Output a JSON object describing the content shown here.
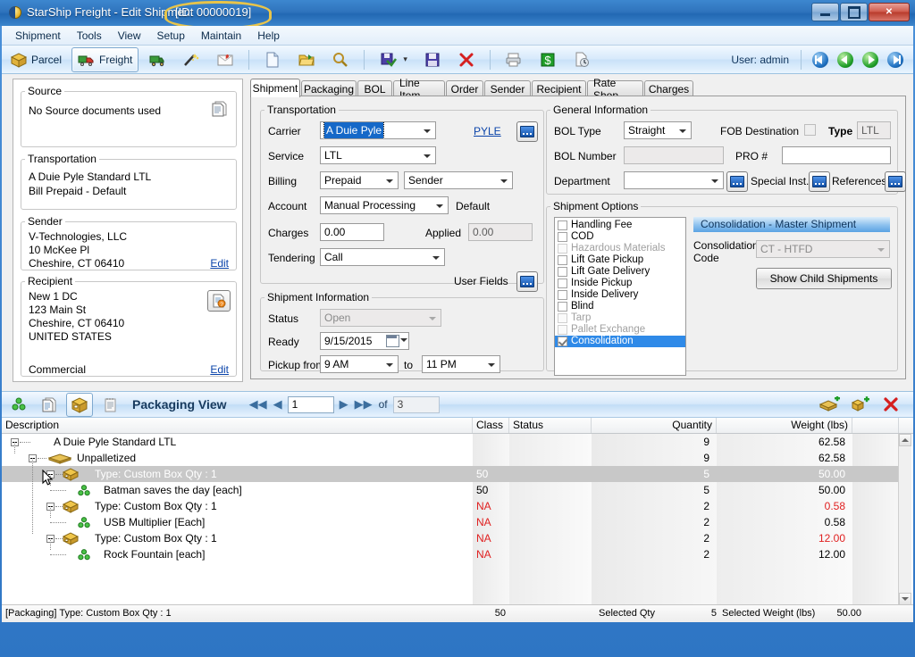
{
  "window": {
    "title": "StarShip Freight - Edit Shipment",
    "id_label": "[ID: 00000019]",
    "minimize": "–",
    "maximize": "□",
    "close": "✕"
  },
  "menu": [
    "Shipment",
    "Tools",
    "View",
    "Setup",
    "Maintain",
    "Help"
  ],
  "toolbar": {
    "parcel": "Parcel",
    "freight": "Freight",
    "user": "User: admin",
    "icons": [
      "truck-icon",
      "wand-icon",
      "mail-icon",
      "new-document-icon",
      "open-folder-icon",
      "search-icon",
      "save-process-icon",
      "save-icon",
      "delete-icon",
      "print-icon",
      "money-icon",
      "history-icon"
    ],
    "nav": [
      "first-record",
      "previous-record",
      "next-record",
      "last-record"
    ]
  },
  "left_panel": {
    "source": {
      "legend": "Source",
      "text": "No Source documents used",
      "icon": "documents-icon"
    },
    "transportation": {
      "legend": "Transportation",
      "line1": "A Duie Pyle Standard LTL",
      "line2": "Bill Prepaid - Default"
    },
    "sender": {
      "legend": "Sender",
      "line1": "V-Technologies, LLC",
      "line2": "10 McKee Pl",
      "line3": "Cheshire, CT 06410",
      "edit": "Edit"
    },
    "recipient": {
      "legend": "Recipient",
      "line1": "New 1 DC",
      "line2": "123 Main St",
      "line3": "Cheshire, CT 06410",
      "line4": "UNITED STATES",
      "type": "Commercial",
      "edit": "Edit",
      "icon": "address-validate-icon"
    }
  },
  "tabs": [
    {
      "label": "Shipment",
      "active": true
    },
    {
      "label": "Packaging",
      "active": false
    },
    {
      "label": "BOL",
      "active": false
    },
    {
      "label": "Line Item",
      "active": false
    },
    {
      "label": "Order",
      "active": false
    },
    {
      "label": "Sender",
      "active": false
    },
    {
      "label": "Recipient",
      "active": false
    },
    {
      "label": "Rate Shop",
      "active": false
    },
    {
      "label": "Charges",
      "active": false
    }
  ],
  "transportation": {
    "legend": "Transportation",
    "carrier_label": "Carrier",
    "carrier_value": "A Duie Pyle",
    "carrier_link": "PYLE",
    "service_label": "Service",
    "service_value": "LTL",
    "billing_label": "Billing",
    "billing_value": "Prepaid",
    "billing_party": "Sender",
    "account_label": "Account",
    "account_value": "Manual Processing",
    "account_note": "Default",
    "charges_label": "Charges",
    "charges_value": "0.00",
    "applied_label": "Applied",
    "applied_value": "0.00",
    "tendering_label": "Tendering",
    "tendering_value": "Call",
    "user_fields_label": "User Fields"
  },
  "shipment_info": {
    "legend": "Shipment Information",
    "status_label": "Status",
    "status_value": "Open",
    "ready_label": "Ready",
    "ready_value": "9/15/2015",
    "pickup_label": "Pickup from",
    "pickup_from": "9 AM",
    "pickup_to_label": "to",
    "pickup_to": "11 PM"
  },
  "general_info": {
    "legend": "General Information",
    "bol_type_label": "BOL Type",
    "bol_type_value": "Straight",
    "fob_label": "FOB Destination",
    "type_label": "Type",
    "type_value": "LTL",
    "bol_number_label": "BOL Number",
    "bol_number_value": "",
    "pro_label": "PRO #",
    "pro_value": "",
    "department_label": "Department",
    "department_value": "",
    "special_inst_label": "Special Inst.",
    "references_label": "References"
  },
  "shipment_options": {
    "legend": "Shipment Options",
    "items": [
      {
        "label": "Handling Fee",
        "checked": false,
        "disabled": false,
        "selected": false
      },
      {
        "label": "COD",
        "checked": false,
        "disabled": false,
        "selected": false
      },
      {
        "label": "Hazardous Materials",
        "checked": false,
        "disabled": true,
        "selected": false
      },
      {
        "label": "Lift Gate Pickup",
        "checked": false,
        "disabled": false,
        "selected": false
      },
      {
        "label": "Lift Gate Delivery",
        "checked": false,
        "disabled": false,
        "selected": false
      },
      {
        "label": "Inside Pickup",
        "checked": false,
        "disabled": false,
        "selected": false
      },
      {
        "label": "Inside Delivery",
        "checked": false,
        "disabled": false,
        "selected": false
      },
      {
        "label": "Blind",
        "checked": false,
        "disabled": false,
        "selected": false
      },
      {
        "label": "Tarp",
        "checked": false,
        "disabled": true,
        "selected": false
      },
      {
        "label": "Pallet Exchange",
        "checked": false,
        "disabled": true,
        "selected": false
      },
      {
        "label": "Consolidation",
        "checked": true,
        "disabled": false,
        "selected": true
      }
    ]
  },
  "consolidation": {
    "header": "Consolidation - Master Shipment",
    "code_label_l1": "Consolidation",
    "code_label_l2": "Code",
    "code_value": "CT - HTFD",
    "show_child_button": "Show Child Shipments"
  },
  "packaging_view": {
    "title": "Packaging View",
    "page_current": "1",
    "of_label": "of",
    "page_total": "3",
    "icons": [
      "groups-icon",
      "detail-list-icon",
      "package-icon",
      "notes-icon",
      "add-pallet-icon",
      "add-package-icon",
      "delete-icon"
    ]
  },
  "grid": {
    "columns": [
      {
        "label": "Description",
        "align": "left"
      },
      {
        "label": "Class",
        "align": "left"
      },
      {
        "label": "Status",
        "align": "left"
      },
      {
        "label": "Quantity",
        "align": "right"
      },
      {
        "label": "Weight (lbs)",
        "align": "right"
      }
    ],
    "rows": [
      {
        "description": "A Duie Pyle Standard LTL",
        "class": "",
        "status": "",
        "quantity": "9",
        "weight": "62.58",
        "level": 0,
        "icon": "",
        "expander": true,
        "selected": false,
        "weight_red": false,
        "class_red": false
      },
      {
        "description": "Unpalletized",
        "class": "",
        "status": "",
        "quantity": "9",
        "weight": "62.58",
        "level": 1,
        "icon": "pallet-icon",
        "expander": true,
        "selected": false,
        "weight_red": false,
        "class_red": false
      },
      {
        "description": "Type: Custom Box  Qty : 1",
        "class": "50",
        "status": "",
        "quantity": "5",
        "weight": "50.00",
        "level": 2,
        "icon": "box-icon",
        "expander": true,
        "selected": true,
        "weight_red": false,
        "class_red": false
      },
      {
        "description": "Batman saves the day [each]",
        "class": "50",
        "status": "",
        "quantity": "5",
        "weight": "50.00",
        "level": 3,
        "icon": "item-icon",
        "expander": false,
        "selected": false,
        "weight_red": false,
        "class_red": false
      },
      {
        "description": "Type: Custom Box  Qty : 1",
        "class": "NA",
        "status": "",
        "quantity": "2",
        "weight": "0.58",
        "level": 2,
        "icon": "box-icon",
        "expander": true,
        "selected": false,
        "weight_red": true,
        "class_red": true
      },
      {
        "description": "USB Multiplier [Each]",
        "class": "NA",
        "status": "",
        "quantity": "2",
        "weight": "0.58",
        "level": 3,
        "icon": "item-icon",
        "expander": false,
        "selected": false,
        "weight_red": false,
        "class_red": true
      },
      {
        "description": "Type: Custom Box  Qty : 1",
        "class": "NA",
        "status": "",
        "quantity": "2",
        "weight": "12.00",
        "level": 2,
        "icon": "box-icon",
        "expander": true,
        "selected": false,
        "weight_red": true,
        "class_red": true
      },
      {
        "description": "Rock Fountain [each]",
        "class": "NA",
        "status": "",
        "quantity": "2",
        "weight": "12.00",
        "level": 3,
        "icon": "item-icon",
        "expander": false,
        "selected": false,
        "weight_red": false,
        "class_red": true
      }
    ]
  },
  "grid_status": {
    "description": "[Packaging] Type: Custom Box  Qty : 1",
    "class": "50",
    "selected_qty_label": "Selected Qty",
    "selected_qty": "5",
    "selected_weight_label": "Selected Weight (lbs)",
    "selected_weight": "50.00"
  },
  "colors": {
    "accent": "#2f8ae8",
    "title_bar": "#2f74bd",
    "link": "#0b44aa",
    "alert_red": "#e02020",
    "annotation": "#e8c44a"
  }
}
